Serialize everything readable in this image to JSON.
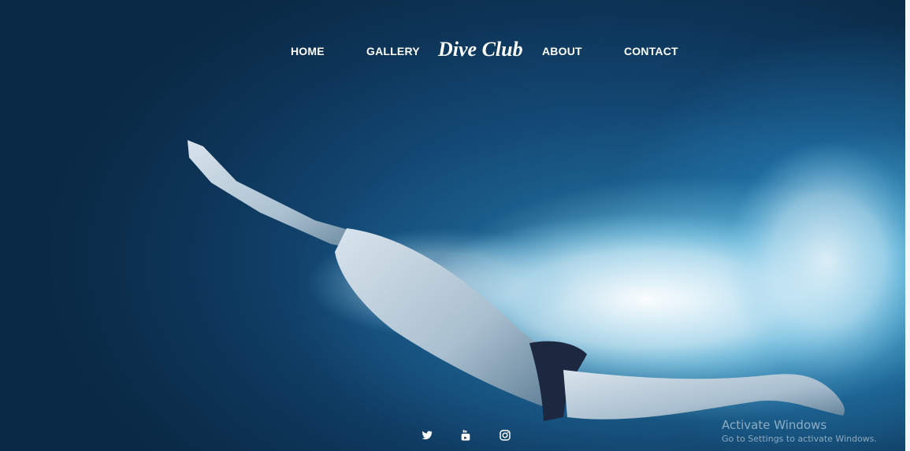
{
  "nav": {
    "home_label": "HOME",
    "gallery_label": "GALLERY",
    "brand": "Dive Club",
    "about_label": "ABOUT",
    "contact_label": "CONTACT"
  },
  "social": {
    "icons": [
      "twitter-icon",
      "youtube-icon",
      "instagram-icon"
    ]
  },
  "watermark": {
    "title": "Activate Windows",
    "subtitle": "Go to Settings to activate Windows."
  },
  "colors": {
    "nav_text": "#ffffff",
    "water_dark": "#0a2944",
    "water_light": "#6fc3e6"
  }
}
